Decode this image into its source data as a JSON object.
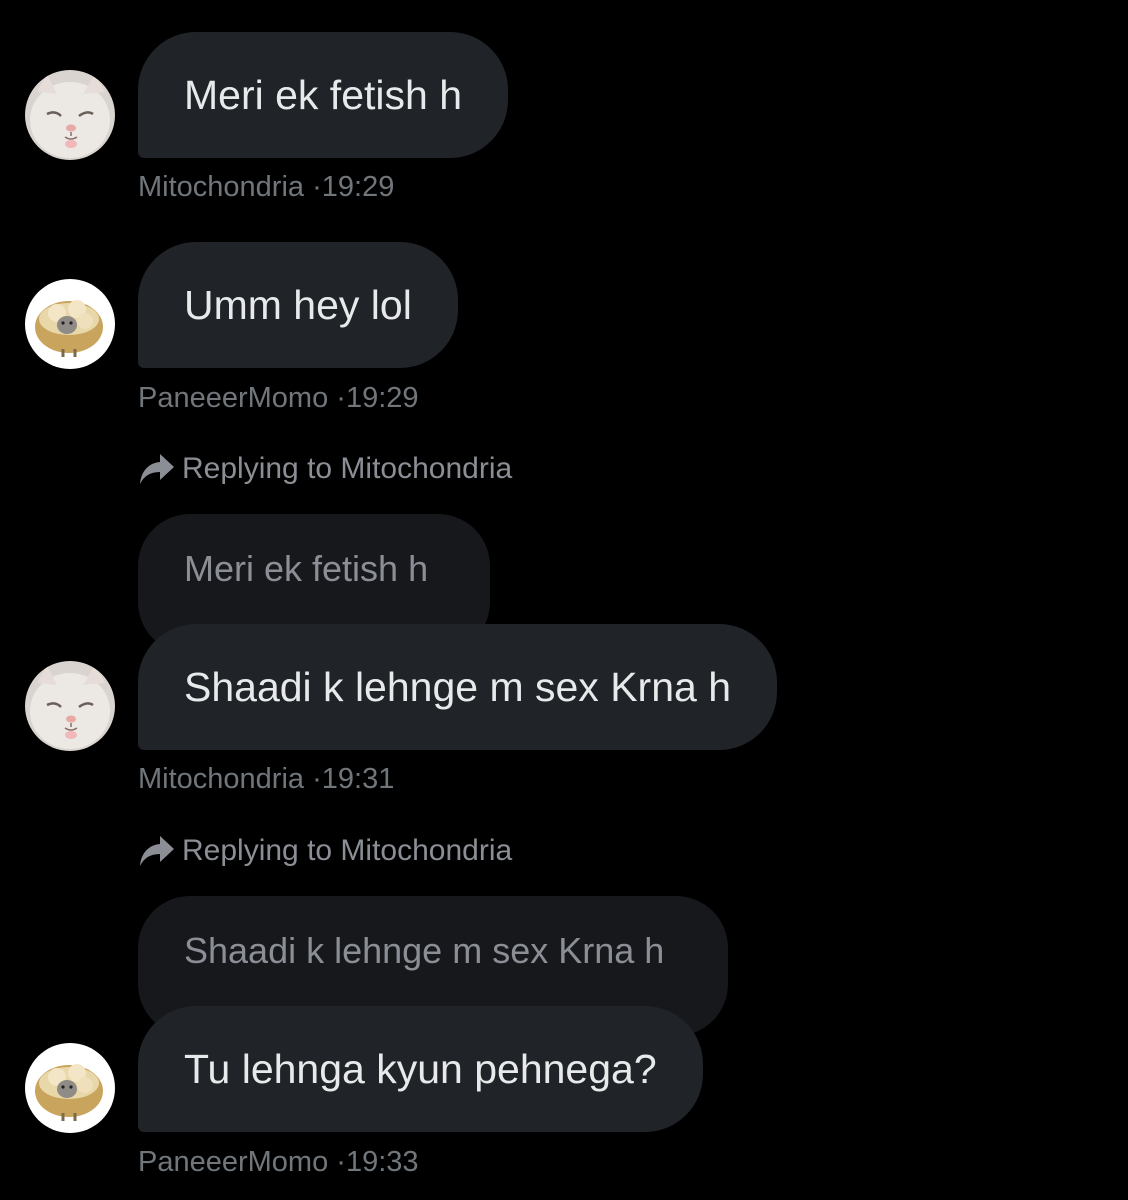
{
  "conversation": {
    "messages": [
      {
        "author": "Mitochondria",
        "text": "Meri ek fetish h",
        "time": "19:29",
        "avatar_icon": "cat-face-avatar"
      },
      {
        "author": "PaneeerMomo",
        "text": "Umm hey lol",
        "time": "19:29",
        "avatar_icon": "momo-basket-avatar"
      },
      {
        "author": "Mitochondria",
        "reply_label": "Replying to Mitochondria",
        "quoted_text": "Meri ek fetish h",
        "text": "Shaadi k lehnge m sex Krna h",
        "time": "19:31",
        "avatar_icon": "cat-face-avatar"
      },
      {
        "author": "PaneeerMomo",
        "reply_label": "Replying to Mitochondria",
        "quoted_text": "Shaadi k lehnge m sex Krna h",
        "text": "Tu lehnga kyun pehnega?",
        "time": "19:33",
        "avatar_icon": "momo-basket-avatar"
      }
    ],
    "separator": "·"
  },
  "colors": {
    "background": "#000000",
    "bubble": "#202327",
    "quoted_bubble": "#16181c",
    "meta_text": "#71767b"
  }
}
